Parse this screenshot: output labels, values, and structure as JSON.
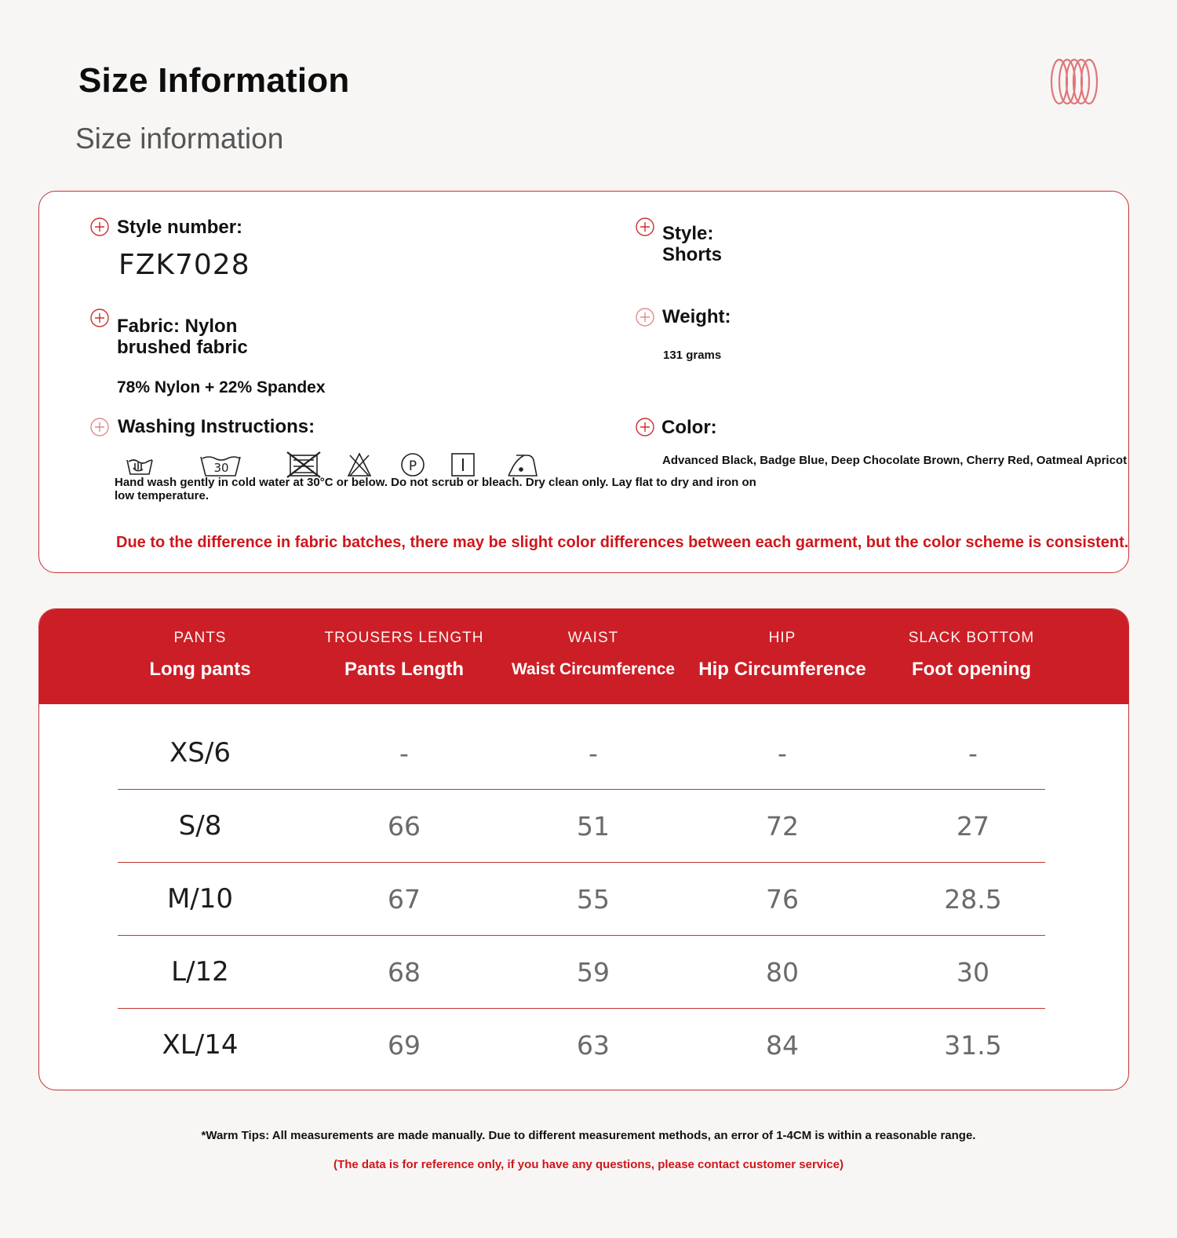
{
  "header": {
    "title": "Size Information",
    "subtitle": "Size information",
    "logo_icon": "red-rings-logo"
  },
  "product": {
    "style_number_label": "Style number:",
    "style_number": "FZK7028",
    "style_label": "Style:",
    "style_value": "Shorts",
    "fabric_label_line1": "Fabric: Nylon",
    "fabric_label_line2": "brushed fabric",
    "fabric_composition": "78% Nylon + 22% Spandex",
    "weight_label": "Weight:",
    "weight_value": "131 grams",
    "washing_label": "Washing Instructions:",
    "washing_icons": [
      "hand-wash-icon",
      "wash-30-icon",
      "do-not-tumble-dry-icon",
      "do-not-bleach-icon",
      "dry-clean-p-icon",
      "line-dry-icon",
      "iron-low-icon"
    ],
    "washing_text": "Hand wash gently in cold water at 30°C or below. Do not scrub or bleach. Dry clean only. Lay flat to dry and iron on low temperature.",
    "wash_icon_label_30": "30",
    "wash_icon_label_p": "P",
    "color_label": "Color:",
    "color_value": "Advanced Black, Badge Blue, Deep Chocolate Brown, Cherry Red, Oatmeal Apricot",
    "notice": "Due to the difference in fabric batches, there may be slight color differences between each garment, but the color scheme is consistent."
  },
  "size_table": {
    "columns": [
      {
        "en": "PANTS",
        "label": "Long pants"
      },
      {
        "en": "TROUSERS LENGTH",
        "label": "Pants Length"
      },
      {
        "en": "WAIST",
        "label": "Waist Circumference"
      },
      {
        "en": "HIP",
        "label": "Hip Circumference"
      },
      {
        "en": "SLACK BOTTOM",
        "label": "Foot opening"
      }
    ],
    "rows": [
      [
        "XS/6",
        "-",
        "-",
        "-",
        "-"
      ],
      [
        "S/8",
        "66",
        "51",
        "72",
        "27"
      ],
      [
        "M/10",
        "67",
        "55",
        "76",
        "28.5"
      ],
      [
        "L/12",
        "68",
        "59",
        "80",
        "30"
      ],
      [
        "XL/14",
        "69",
        "63",
        "84",
        "31.5"
      ]
    ]
  },
  "footer": {
    "tip": "*Warm Tips: All measurements are made manually. Due to different measurement methods, an error of 1-4CM is within a reasonable range.",
    "reference": "(The data is for reference only, if you have any questions, please contact customer service)"
  },
  "colors": {
    "accent": "#cc1e26",
    "border": "#c8302f",
    "notice_text": "#d0161a"
  }
}
